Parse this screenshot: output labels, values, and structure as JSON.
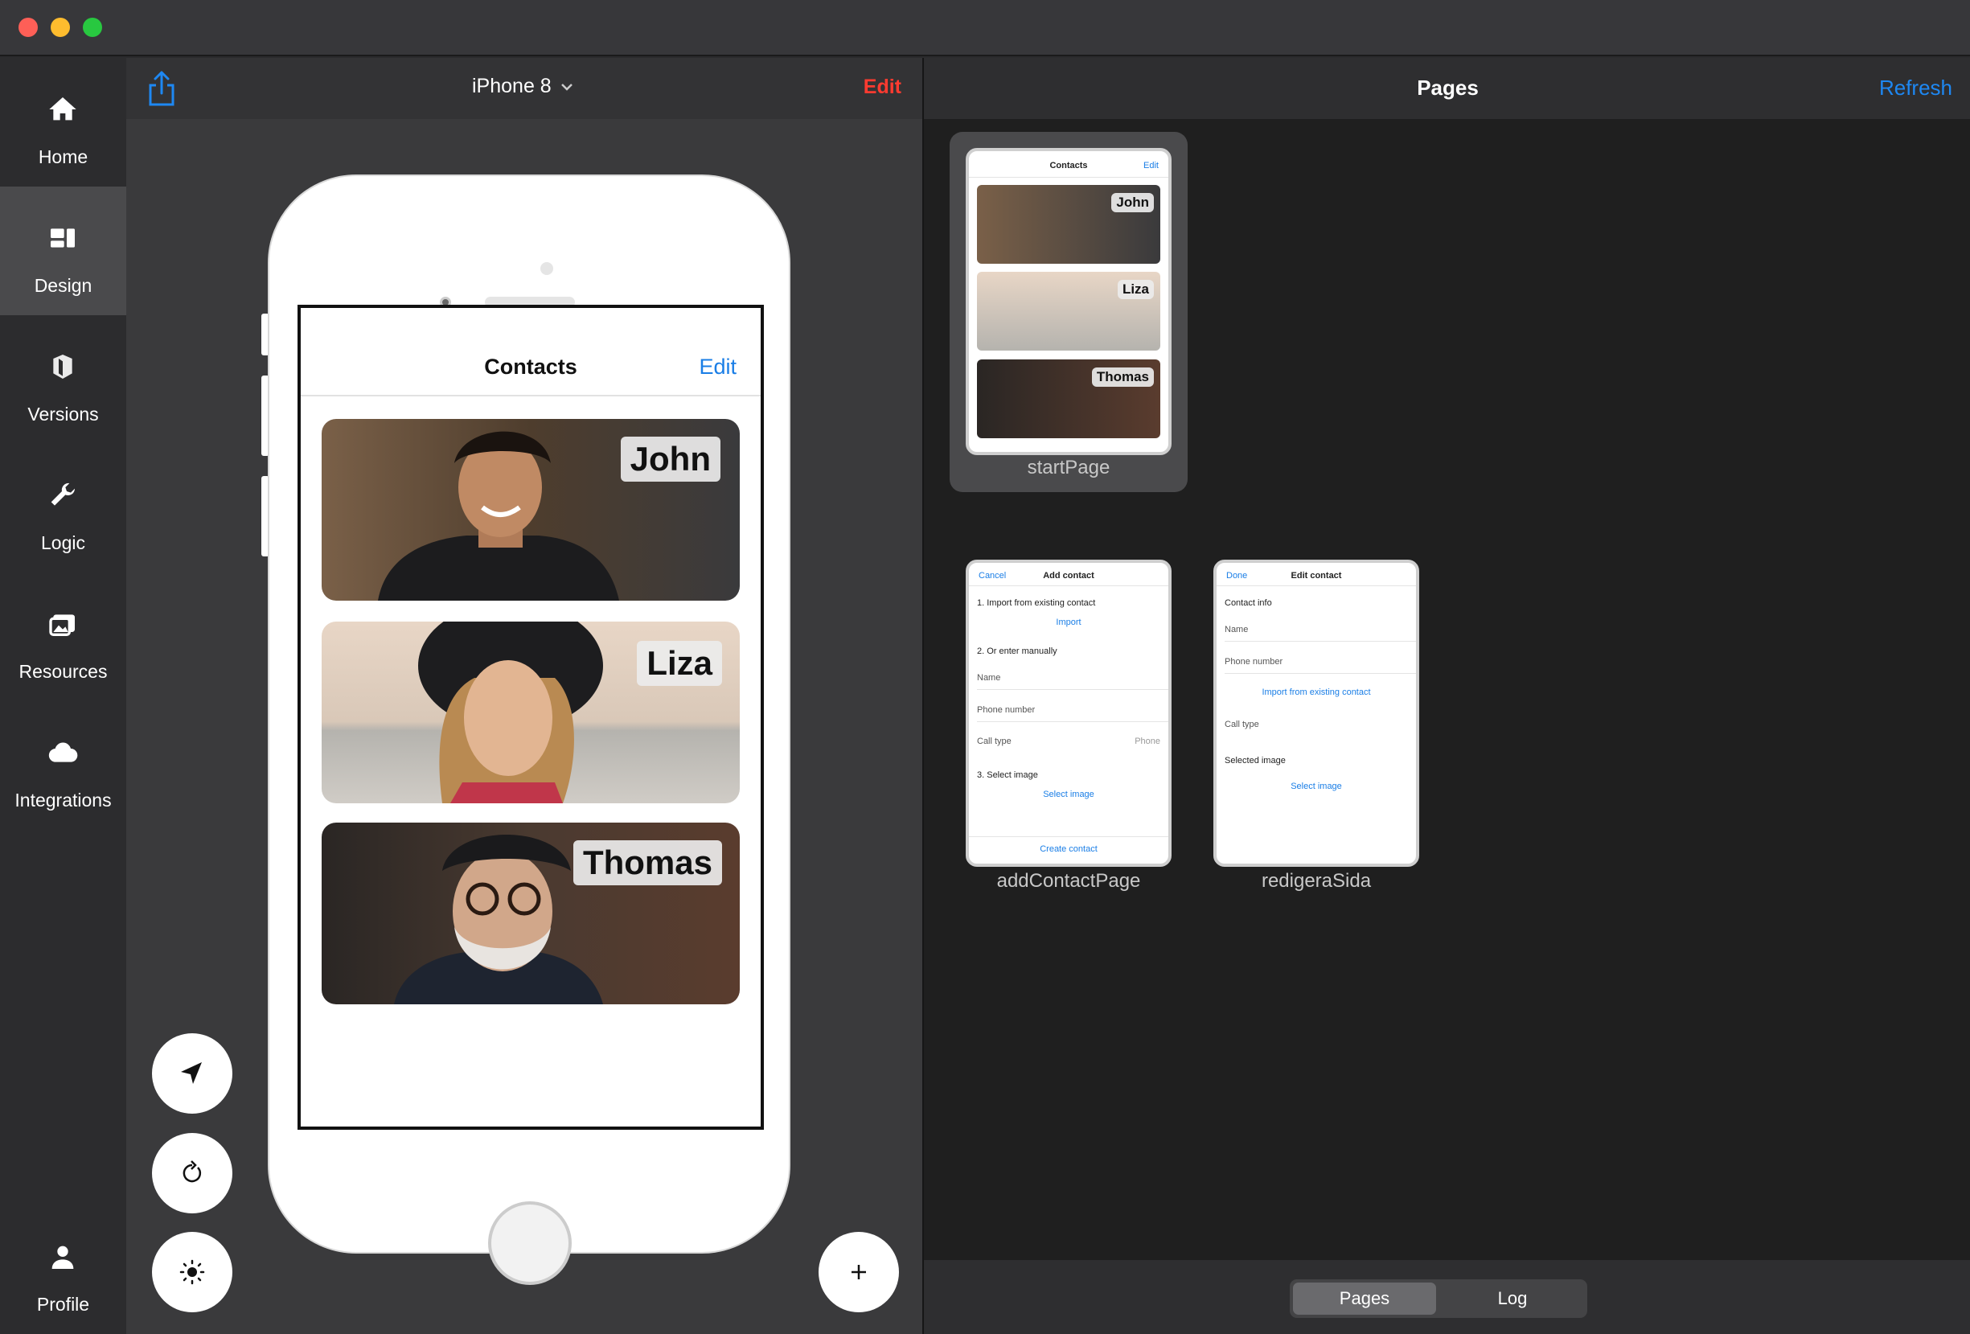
{
  "sidebar": {
    "items": [
      {
        "label": "Home",
        "icon": "house-icon"
      },
      {
        "label": "Design",
        "icon": "layout-icon"
      },
      {
        "label": "Versions",
        "icon": "cube-stack-icon"
      },
      {
        "label": "Logic",
        "icon": "wrench-icon"
      },
      {
        "label": "Resources",
        "icon": "images-icon"
      },
      {
        "label": "Integrations",
        "icon": "cloud-icon"
      }
    ],
    "profile_label": "Profile",
    "active": "Design"
  },
  "editor": {
    "device": "iPhone 8",
    "edit_label": "Edit"
  },
  "preview": {
    "title": "Contacts",
    "edit_label": "Edit",
    "contacts": [
      "John",
      "Liza",
      "Thomas"
    ]
  },
  "pages_panel": {
    "title": "Pages",
    "refresh_label": "Refresh",
    "pages": [
      {
        "name": "startPage",
        "mini_title": "Contacts",
        "mini_edit": "Edit",
        "contacts": [
          "John",
          "Liza",
          "Thomas"
        ]
      },
      {
        "name": "addContactPage",
        "cancel": "Cancel",
        "title": "Add contact",
        "step1": "1. Import from existing contact",
        "import": "Import",
        "step2": "2. Or enter manually",
        "name_field": "Name",
        "phone_field": "Phone number",
        "call_type": "Call type",
        "call_type_value": "Phone",
        "step3": "3. Select image",
        "select_image": "Select image",
        "create": "Create contact"
      },
      {
        "name": "redigeraSida",
        "done": "Done",
        "title": "Edit contact",
        "section": "Contact info",
        "name_field": "Name",
        "phone_field": "Phone number",
        "import": "Import from existing contact",
        "call_type": "Call type",
        "selected_image": "Selected image",
        "select_image": "Select image"
      }
    ]
  },
  "tabs": {
    "pages": "Pages",
    "log": "Log",
    "active": "Pages"
  },
  "colors": {
    "accent_blue": "#1e88f3",
    "edit_red": "#ff3b30"
  }
}
